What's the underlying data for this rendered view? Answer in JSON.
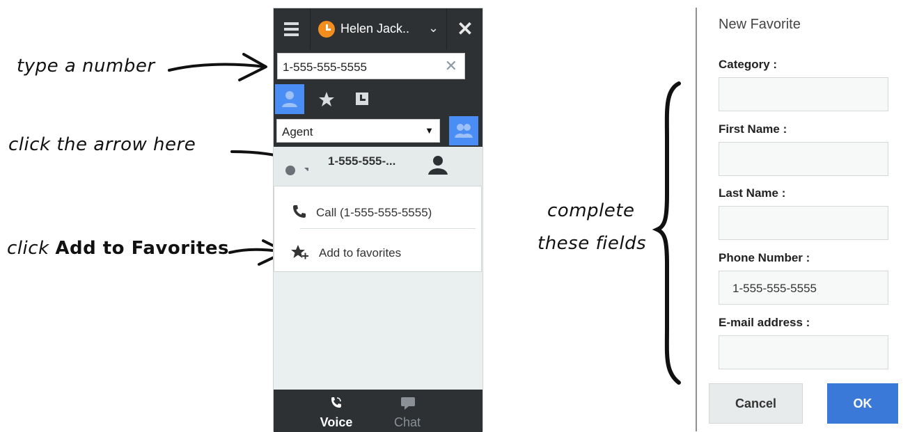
{
  "annotations": {
    "type_number": "type a number",
    "click_arrow": "click the arrow  here",
    "click_add_prefix": "click ",
    "click_add_bold": "Add to Favorites",
    "complete_line1": "complete",
    "complete_line2": "these fields"
  },
  "app": {
    "user_name": "Helen Jack..",
    "status_color": "#f28e1e",
    "search_value": "1-555-555-5555",
    "filter_selected": "Agent",
    "result_number": "1-555-555-...",
    "menu": {
      "call_label": "Call (1-555-555-5555)",
      "favorite_label": "Add to favorites"
    },
    "bottom_tabs": {
      "voice": "Voice",
      "chat": "Chat"
    },
    "accent_color": "#4a8df5"
  },
  "dialog": {
    "title": "New Favorite",
    "fields": {
      "category_label": "Category :",
      "category_value": "",
      "first_name_label": "First Name :",
      "first_name_value": "",
      "last_name_label": "Last Name :",
      "last_name_value": "",
      "phone_label": "Phone Number :",
      "phone_value": "1-555-555-5555",
      "email_label": "E-mail address :",
      "email_value": ""
    },
    "cancel_label": "Cancel",
    "ok_label": "OK",
    "ok_color": "#3b79d9"
  }
}
